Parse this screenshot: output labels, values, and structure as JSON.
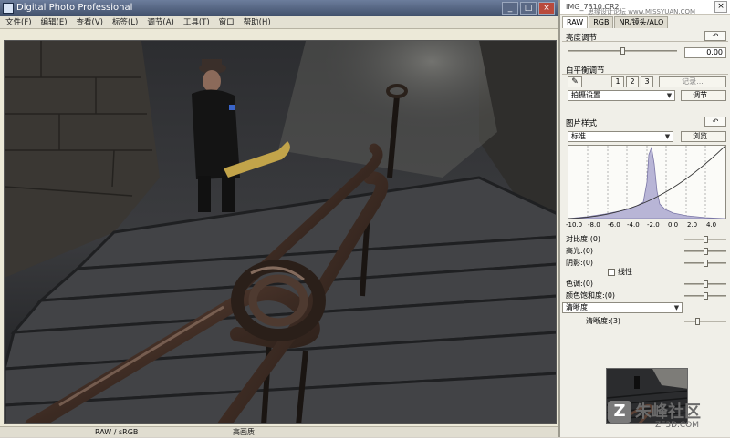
{
  "window": {
    "title": "Digital Photo Professional",
    "buttons": [
      "_",
      "□",
      "×"
    ]
  },
  "menu": [
    "文件(F)",
    "编辑(E)",
    "查看(V)",
    "标签(L)",
    "调节(A)",
    "工具(T)",
    "窗口",
    "帮助(H)"
  ],
  "status": {
    "color_info": "RAW / sRGB",
    "quality": "高画质"
  },
  "palette": {
    "title": "IMG_7310.CR2",
    "watermark_overlay": "思缘设计论坛 www.MISSYUAN.COM",
    "tabs": [
      "RAW",
      "RGB",
      "NR/镜头/ALO"
    ],
    "brightness": {
      "label": "亮度调节",
      "reset": "↶",
      "value": "0.00",
      "level": 0.5
    },
    "white_balance": {
      "label": "白平衡调节",
      "reset": "↶",
      "presets": [
        "1",
        "2",
        "3"
      ],
      "register_button": "记录...",
      "mode": "拍摄设置",
      "adjust_button": "调节..."
    },
    "picture_style": {
      "label": "图片样式",
      "reset": "↶",
      "style": "标准",
      "browse_button": "浏览...",
      "histogram_ticks": [
        "-10.0",
        "-8.0",
        "-6.0",
        "-4.0",
        "-2.0",
        "0.0",
        "2.0",
        "4.0"
      ],
      "sliders": [
        {
          "label": "对比度",
          "value": "(0)",
          "level": 0.5
        },
        {
          "label": "高光",
          "value": "(0)",
          "level": 0.5
        },
        {
          "label": "阴影",
          "value": "(0)",
          "level": 0.5
        },
        {
          "label": "色调",
          "value": "(0)",
          "level": 0.5
        },
        {
          "label": "颜色饱和度",
          "value": "(0)",
          "level": 0.5
        }
      ],
      "linear_label": "线性",
      "sharpness_mode": "清晰度",
      "sharpness": {
        "label": "清晰度",
        "value": "(3)",
        "level": 0.3
      }
    }
  },
  "watermark": {
    "logo": "Z",
    "name": "朱峰社区",
    "sub": "ZF3D.COM"
  },
  "colors": {
    "titlebar": "#4a5874",
    "histogram_fill": "#b8b5d6",
    "photo_bg": "#1b1c1f"
  }
}
